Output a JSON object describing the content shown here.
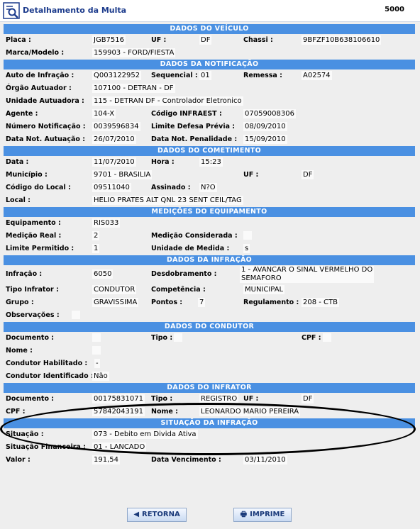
{
  "window": {
    "title": "Detalhamento da Multa",
    "code": "5000",
    "icon": "magnifier-document-icon"
  },
  "sections": {
    "veiculo": "DADOS DO VEÍCULO",
    "notificacao": "DADOS DA NOTIFICAÇÃO",
    "cometimento": "DADOS DO COMETIMENTO",
    "medicoes": "MEDIÇÕES DO EQUIPAMENTO",
    "infracao": "DADOS DA INFRAÇÃO",
    "condutor": "DADOS DO CONDUTOR",
    "infrator": "DADOS DO INFRATOR",
    "situacao": "SITUAÇÃO DA INFRAÇÃO"
  },
  "veiculo": {
    "placa_label": "Placa :",
    "placa": "JGB7516",
    "uf_label": "UF :",
    "uf": "DF",
    "chassi_label": "Chassi :",
    "chassi": "9BFZF10B638106610",
    "marca_label": "Marca/Modelo :",
    "marca": "159903 - FORD/FIESTA"
  },
  "notificacao": {
    "auto_label": "Auto de Infração :",
    "auto": "Q003122952",
    "seq_label": "Sequencial :",
    "seq": "01",
    "remessa_label": "Remessa :",
    "remessa": "A02574",
    "orgao_label": "Órgão Autuador :",
    "orgao": "107100 - DETRAN - DF",
    "unidade_label": "Unidade Autuadora :",
    "unidade": "115 - DETRAN DF - Controlador Eletronico",
    "agente_label": "Agente :",
    "agente": "104-X",
    "infraest_label": "Código INFRAEST :",
    "infraest": "07059008306",
    "numnot_label": "Número Notificação :",
    "numnot": "0039596834",
    "limite_label": "Limite Defesa Prévia :",
    "limite": "08/09/2010",
    "dtaut_label": "Data Not. Autuação :",
    "dtaut": "26/07/2010",
    "dtpen_label": "Data Not. Penalidade :",
    "dtpen": "15/09/2010"
  },
  "cometimento": {
    "data_label": "Data :",
    "data": "11/07/2010",
    "hora_label": "Hora :",
    "hora": "15:23",
    "municipio_label": "Município :",
    "municipio": "9701 - BRASILIA",
    "uf_label": "UF :",
    "uf": "DF",
    "codlocal_label": "Código do Local :",
    "codlocal": "09511040",
    "assinado_label": "Assinado :",
    "assinado": "N?O",
    "local_label": "Local :",
    "local": "HELIO PRATES ALT QNL 23 SENT CEIL/TAG"
  },
  "medicoes": {
    "equip_label": "Equipamento :",
    "equip": "RIS033",
    "medreal_label": "Medição Real :",
    "medreal": "2",
    "medcons_label": "Medição Considerada :",
    "medcons": "",
    "limperm_label": "Limite Permitido :",
    "limperm": "1",
    "unid_label": "Unidade de Medida :",
    "unid": "s"
  },
  "infracao": {
    "infracao_label": "Infração :",
    "infracao": "6050",
    "desdob_label": "Desdobramento :",
    "desdob": "1 - AVANCAR O SINAL VERMELHO DO",
    "desdob2": "SEMAFORO",
    "tipo_label": "Tipo Infrator :",
    "tipo": "CONDUTOR",
    "comp_label": "Competência :",
    "comp": "MUNICIPAL",
    "grupo_label": "Grupo :",
    "grupo": "GRAVISSIMA",
    "pontos_label": "Pontos :",
    "pontos": "7",
    "regul_label": "Regulamento :",
    "regul": "208 - CTB",
    "obs_label": "Observações :",
    "obs": ""
  },
  "condutor": {
    "doc_label": "Documento :",
    "doc": "",
    "tipo_label": "Tipo :",
    "tipo": "",
    "cpf_label": "CPF :",
    "cpf": "",
    "nome_label": "Nome :",
    "nome": "",
    "habil_label": "Condutor Habilitado :",
    "habil": "-",
    "ident_label": "Condutor Identificado :",
    "ident": "Não"
  },
  "infrator": {
    "doc_label": "Documento :",
    "doc": "00175831071",
    "tipo_label": "Tipo :",
    "tipo": "REGISTRO",
    "uf_label": "UF :",
    "uf": "DF",
    "cpf_label": "CPF :",
    "cpf": "57842043191",
    "nome_label": "Nome :",
    "nome": "LEONARDO MARIO PEREIRA"
  },
  "situacao": {
    "sit_label": "Situação :",
    "sit": "073 - Debito em Divida Ativa",
    "fin_label": "Situação Financeira :",
    "fin": "01 - LANCADO",
    "valor_label": "Valor :",
    "valor": "191,54",
    "venc_label": "Data Vencimento :",
    "venc": "03/11/2010"
  },
  "buttons": {
    "retorna": "RETORNA",
    "imprime": "IMPRIME",
    "retorna_icon": "left-arrow-icon",
    "imprime_icon": "printer-icon"
  }
}
